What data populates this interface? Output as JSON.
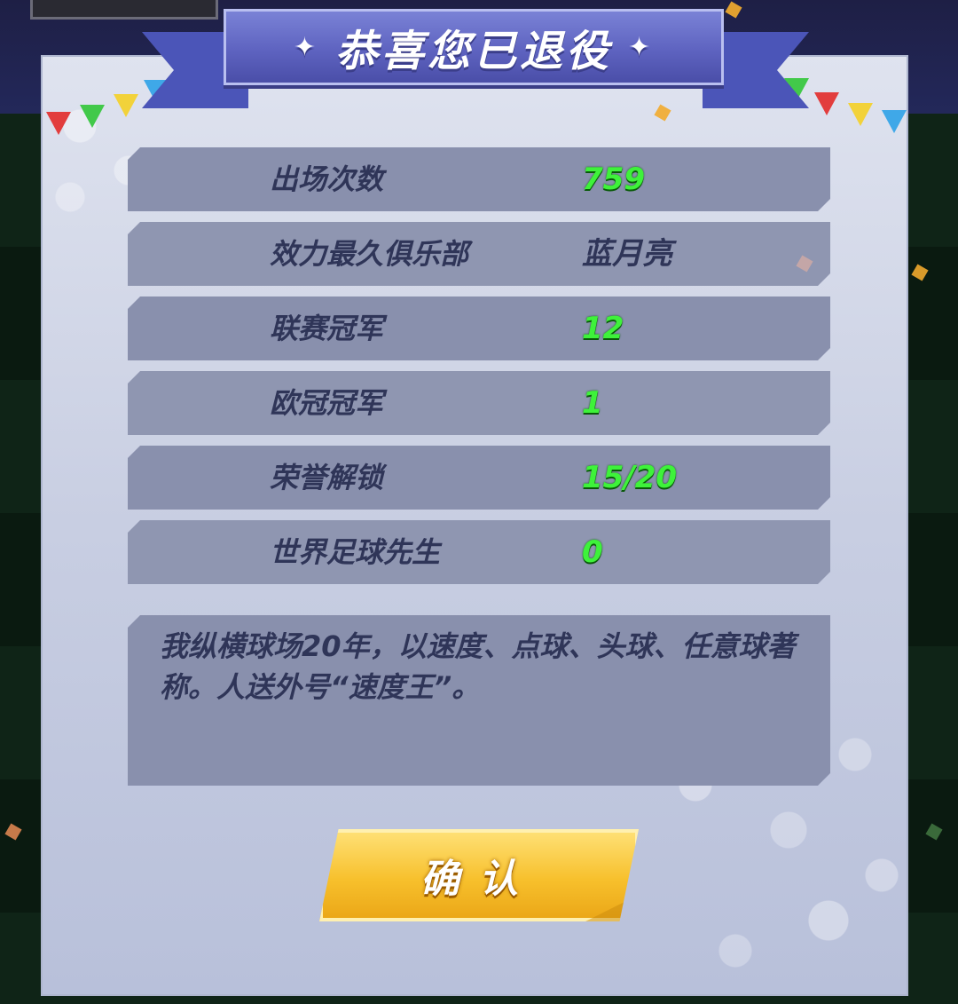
{
  "banner": {
    "title": "恭喜您已退役",
    "sparkle": "✦"
  },
  "stats": [
    {
      "label": "出场次数",
      "value": "759",
      "value_style": "green"
    },
    {
      "label": "效力最久俱乐部",
      "value": "蓝月亮",
      "value_style": "dark"
    },
    {
      "label": "联赛冠军",
      "value": "12",
      "value_style": "green"
    },
    {
      "label": "欧冠冠军",
      "value": "1",
      "value_style": "green"
    },
    {
      "label": "荣誉解锁",
      "value": "15/20",
      "value_style": "green"
    },
    {
      "label": "世界足球先生",
      "value": "0",
      "value_style": "green"
    }
  ],
  "description": "我纵横球场20年，以速度、点球、头球、任意球著称。人送外号“速度王”。",
  "confirm_button": {
    "label": "确认"
  },
  "colors": {
    "value_green": "#3ef23a",
    "banner_blue": "#5e63c0",
    "button_gold": "#f7c02c",
    "panel": "#c8cee2",
    "row": "#8990ad"
  }
}
